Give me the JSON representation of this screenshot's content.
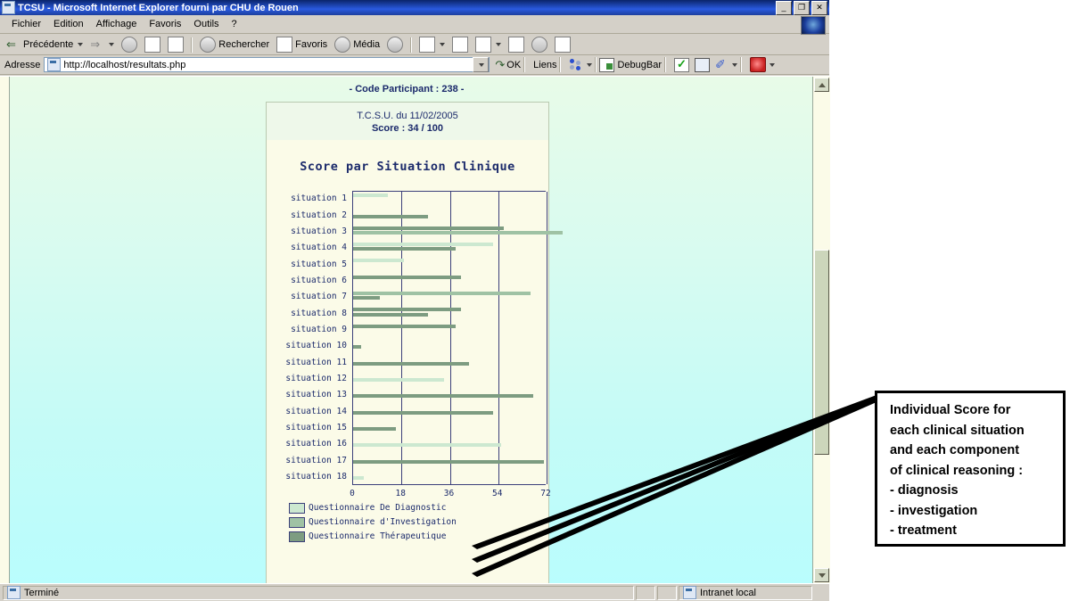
{
  "window": {
    "title": "TCSU - Microsoft Internet Explorer fourni par CHU de Rouen",
    "icon": "ie-document-icon",
    "minimize_label": "_",
    "restore_label": "❐",
    "close_label": "✕"
  },
  "menu": {
    "items": [
      {
        "label": "Fichier",
        "accel": "F"
      },
      {
        "label": "Edition",
        "accel": "E"
      },
      {
        "label": "Affichage",
        "accel": "A"
      },
      {
        "label": "Favoris",
        "accel": "v"
      },
      {
        "label": "Outils",
        "accel": "O"
      },
      {
        "label": "?",
        "accel": ""
      }
    ]
  },
  "toolbar": {
    "back_label": "Précédente",
    "forward_label": "",
    "search_label": "Rechercher",
    "favorites_label": "Favoris",
    "media_label": "Média",
    "history_label": "",
    "mail_label": "",
    "print_label": "",
    "edit_label": "",
    "discuss_label": "",
    "messenger_label": "",
    "research_label": ""
  },
  "address": {
    "label": "Adresse",
    "value": "http://localhost/resultats.php",
    "placeholder": "http://",
    "go_label": "OK",
    "links_label": "Liens",
    "debugbar_label": "DebugBar"
  },
  "content": {
    "participant_code": "- Code Participant : 238 -",
    "test_title": "T.C.S.U. du 11/02/2005",
    "score_line": "Score : 34 / 100"
  },
  "chart_data": {
    "type": "bar",
    "orientation": "horizontal",
    "title": "Score par Situation Clinique",
    "xlabel": "",
    "ylabel": "",
    "xlim": [
      0,
      72
    ],
    "xticks": [
      0,
      18,
      36,
      54,
      72
    ],
    "xticklabels": [
      "0",
      "18",
      "36",
      "54",
      "72"
    ],
    "grid": true,
    "legend_position": "below",
    "categories": [
      "situation 1",
      "situation 2",
      "situation 3",
      "situation 4",
      "situation 5",
      "situation 6",
      "situation 7",
      "situation 8",
      "situation 9",
      "situation 10",
      "situation 11",
      "situation 12",
      "situation 13",
      "situation 14",
      "situation 15",
      "situation 16",
      "situation 17",
      "situation 18"
    ],
    "series": [
      {
        "name": "Questionnaire De Diagnostic",
        "color": "#cce8d0",
        "values": [
          13,
          0,
          0,
          52,
          19,
          0,
          0,
          0,
          0,
          0,
          0,
          34,
          0,
          0,
          0,
          55,
          0,
          4
        ]
      },
      {
        "name": "Questionnaire d'Investigation",
        "color": "#9fc2a4",
        "values": [
          0,
          0,
          78,
          0,
          0,
          0,
          66,
          0,
          0,
          0,
          0,
          0,
          0,
          0,
          0,
          0,
          0,
          0
        ]
      },
      {
        "name": "Questionnaire Thérapeutique",
        "color": "#7d9c81",
        "values": [
          0,
          28,
          56,
          38,
          0,
          40,
          10,
          40,
          38,
          3,
          43,
          0,
          67,
          52,
          16,
          0,
          71,
          0
        ]
      }
    ],
    "legend": [
      {
        "label": "Questionnaire De Diagnostic",
        "color": "#cce8d0"
      },
      {
        "label": "Questionnaire d'Investigation",
        "color": "#9fc2a4"
      },
      {
        "label": "Questionnaire Thérapeutique",
        "color": "#7d9c81"
      }
    ],
    "bar_rows": [
      {
        "category": "situation 1",
        "bars": [
          {
            "series": 0,
            "value": 13,
            "offset": 0
          },
          {
            "series": 1,
            "value": 0,
            "offset": 1
          },
          {
            "series": 2,
            "value": 0,
            "offset": 2
          }
        ]
      },
      {
        "category": "situation 2",
        "bars": [
          {
            "series": 2,
            "value": 28,
            "offset": 1
          }
        ]
      },
      {
        "category": "situation 3",
        "bars": [
          {
            "series": 2,
            "value": 56,
            "offset": 0
          },
          {
            "series": 1,
            "value": 78,
            "offset": 1
          }
        ]
      },
      {
        "category": "situation 4",
        "bars": [
          {
            "series": 0,
            "value": 52,
            "offset": 0
          },
          {
            "series": 2,
            "value": 38,
            "offset": 1
          }
        ]
      },
      {
        "category": "situation 5",
        "bars": [
          {
            "series": 0,
            "value": 19,
            "offset": 0
          }
        ]
      },
      {
        "category": "situation 6",
        "bars": [
          {
            "series": 2,
            "value": 40,
            "offset": 0
          }
        ]
      },
      {
        "category": "situation 7",
        "bars": [
          {
            "series": 1,
            "value": 66,
            "offset": 0
          },
          {
            "series": 2,
            "value": 10,
            "offset": 1
          }
        ]
      },
      {
        "category": "situation 8",
        "bars": [
          {
            "series": 2,
            "value": 40,
            "offset": 0
          },
          {
            "series": 2,
            "value": 28,
            "offset": 1
          }
        ]
      },
      {
        "category": "situation 9",
        "bars": [
          {
            "series": 2,
            "value": 38,
            "offset": 0
          }
        ]
      },
      {
        "category": "situation 10",
        "bars": [
          {
            "series": 2,
            "value": 3,
            "offset": 1
          }
        ]
      },
      {
        "category": "situation 11",
        "bars": [
          {
            "series": 2,
            "value": 43,
            "offset": 1
          }
        ]
      },
      {
        "category": "situation 12",
        "bars": [
          {
            "series": 0,
            "value": 34,
            "offset": 1
          }
        ]
      },
      {
        "category": "situation 13",
        "bars": [
          {
            "series": 2,
            "value": 67,
            "offset": 1
          }
        ]
      },
      {
        "category": "situation 14",
        "bars": [
          {
            "series": 2,
            "value": 52,
            "offset": 1
          }
        ]
      },
      {
        "category": "situation 15",
        "bars": [
          {
            "series": 2,
            "value": 16,
            "offset": 1
          }
        ]
      },
      {
        "category": "situation 16",
        "bars": [
          {
            "series": 0,
            "value": 55,
            "offset": 1
          }
        ]
      },
      {
        "category": "situation 17",
        "bars": [
          {
            "series": 2,
            "value": 71,
            "offset": 1
          }
        ]
      },
      {
        "category": "situation 18",
        "bars": [
          {
            "series": 0,
            "value": 4,
            "offset": 1
          }
        ]
      }
    ]
  },
  "callout": {
    "lines": [
      "Individual Score for",
      "each clinical situation",
      "and each component",
      "of clinical reasoning :",
      "- diagnosis",
      "- investigation",
      "- treatment"
    ]
  },
  "statusbar": {
    "status": "Terminé",
    "zone": "Intranet local"
  },
  "colors": {
    "titlebar": "#0a246a",
    "series_light": "#cce8d0",
    "series_mid": "#9fc2a4",
    "series_dark": "#7d9c81",
    "chart_text": "#1b2a6b"
  }
}
